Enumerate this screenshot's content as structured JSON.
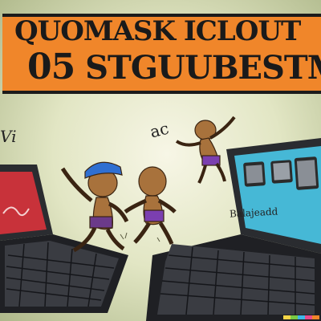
{
  "headline": {
    "line1": "QUOMASK ICLOUT",
    "line2_number": "05",
    "line2_text": "STGUUBESTMD"
  },
  "scribbles": {
    "left_edge": "Vi",
    "above_figures": "ac"
  },
  "right_laptop_screen": {
    "caption": "Balajeadd"
  },
  "colors": {
    "banner": "#f0862a",
    "background": "#e2e6c4",
    "left_screen": "#c8323a",
    "right_screen": "#46b8d6",
    "figure_skin": "#a8723c",
    "laptop_body": "#2a2c30"
  },
  "color_strip": [
    "#f5d547",
    "#7ac943",
    "#3db8e8",
    "#e84b8a",
    "#f0862a"
  ]
}
